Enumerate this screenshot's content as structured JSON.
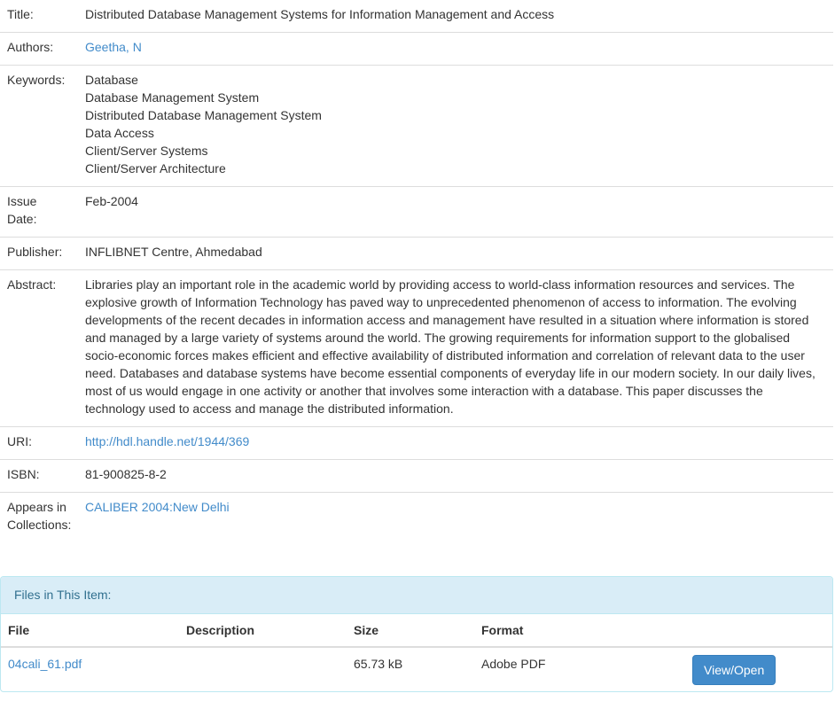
{
  "metadata": {
    "title_label": "Title:",
    "title": "Distributed Database Management Systems for Information Management and Access",
    "authors_label": "Authors:",
    "author": "Geetha, N",
    "keywords_label": "Keywords:",
    "keywords": [
      "Database",
      "Database Management System",
      "Distributed Database Management System",
      "Data Access",
      "Client/Server Systems",
      "Client/Server Architecture"
    ],
    "issue_date_label_1": "Issue",
    "issue_date_label_2": "Date:",
    "issue_date": "Feb-2004",
    "publisher_label": "Publisher:",
    "publisher": "INFLIBNET Centre, Ahmedabad",
    "abstract_label": "Abstract:",
    "abstract": "Libraries play an important role in the academic world by providing access to world-class information resources and services. The explosive growth of Information Technology has paved way to unprecedented phenomenon of access to information. The evolving developments of the recent decades in information access and management have resulted in a situation where information is stored and managed by a large variety of systems around the world. The growing requirements for information support to the globalised socio-economic forces makes efficient and effective availability of distributed information and correlation of relevant data to the user need. Databases and database systems have become essential components of everyday life in our modern society. In our daily lives, most of us would engage in one activity or another that involves some interaction with a database. This paper discusses the technology used to access and manage the distributed information.",
    "uri_label": "URI:",
    "uri": "http://hdl.handle.net/1944/369",
    "isbn_label": "ISBN:",
    "isbn": "81-900825-8-2",
    "collections_label_1": "Appears in",
    "collections_label_2": "Collections:",
    "collection": "CALIBER 2004:New Delhi"
  },
  "files": {
    "heading": "Files in This Item:",
    "columns": {
      "file": "File",
      "description": "Description",
      "size": "Size",
      "format": "Format"
    },
    "rows": [
      {
        "file": "04cali_61.pdf",
        "description": "",
        "size": "65.73 kB",
        "format": "Adobe PDF",
        "action": "View/Open"
      }
    ]
  },
  "colors": {
    "link": "#428bca",
    "panel_heading_bg": "#d9edf7",
    "panel_heading_text": "#31708f",
    "button_bg": "#428bca"
  }
}
